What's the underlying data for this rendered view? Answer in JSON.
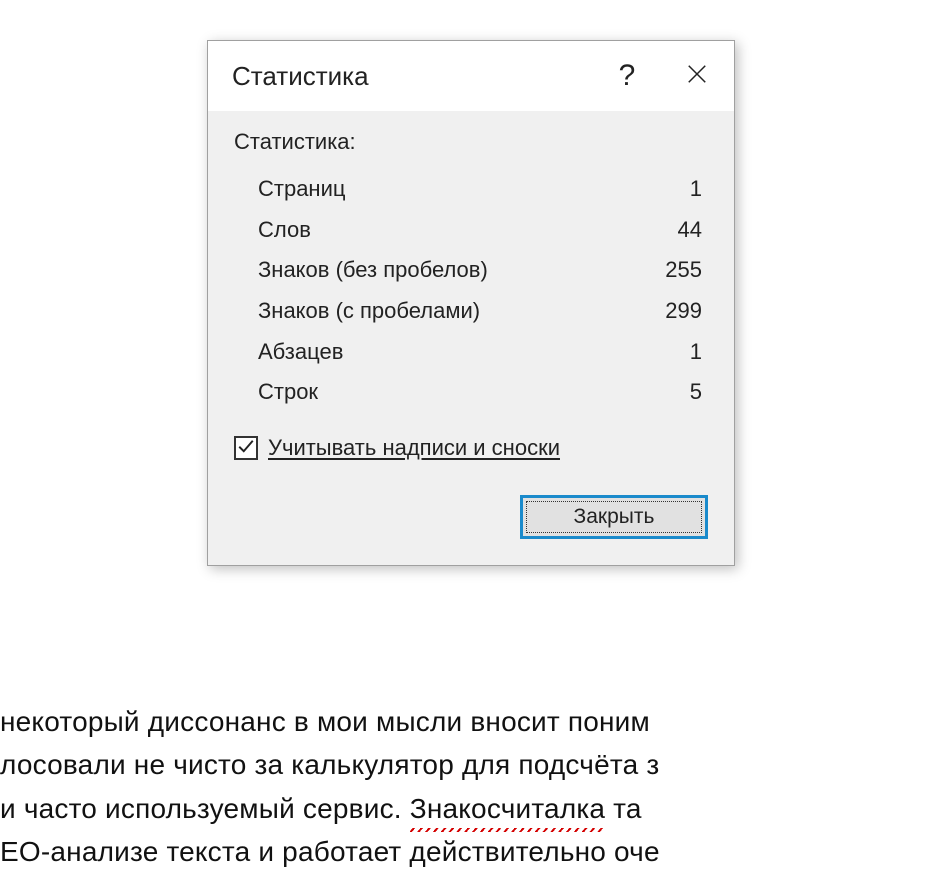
{
  "dialog": {
    "title": "Статистика",
    "help_glyph": "?",
    "section_label": "Статистика:",
    "stats": [
      {
        "label": "Страниц",
        "value": "1"
      },
      {
        "label": "Слов",
        "value": "44"
      },
      {
        "label": "Знаков (без пробелов)",
        "value": "255"
      },
      {
        "label": "Знаков (с пробелами)",
        "value": "299"
      },
      {
        "label": "Абзацев",
        "value": "1"
      },
      {
        "label": "Строк",
        "value": "5"
      }
    ],
    "checkbox": {
      "checked": true,
      "label": "Учитывать надписи и сноски"
    },
    "close_label": "Закрыть"
  },
  "document": {
    "lines": [
      "некоторый диссонанс в мои мысли вносит поним",
      "лосовали не чисто за калькулятор для подсчёта з",
      "и часто используемый сервис. Знакосчиталка та",
      "ЕО-анализе текста и работает действительно оче"
    ],
    "squiggle_word": "Знакосчиталка",
    "squiggle_line_index": 2
  }
}
